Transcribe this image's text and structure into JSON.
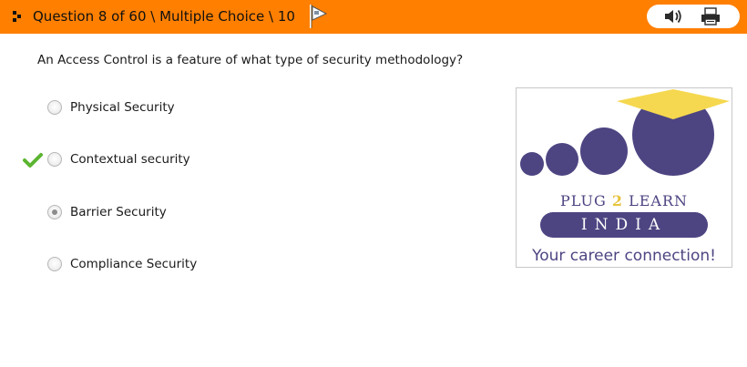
{
  "header": {
    "title": "Question 8 of 60 \\ Multiple Choice \\ 10",
    "colors": {
      "bar": "#ff7f00",
      "pill": "#ffffff"
    },
    "icons": {
      "grip": "grip-icon",
      "flag": "flag-icon",
      "audio": "speaker-icon",
      "print": "printer-icon"
    }
  },
  "question": {
    "text": "An Access Control is a feature of what type of security methodology?"
  },
  "options": [
    {
      "label": "Physical Security",
      "selected": false,
      "correct": false
    },
    {
      "label": "Contextual security",
      "selected": false,
      "correct": true
    },
    {
      "label": "Barrier Security",
      "selected": true,
      "correct": false
    },
    {
      "label": "Compliance Security",
      "selected": false,
      "correct": false
    }
  ],
  "correct_marker": {
    "icon": "checkmark-icon",
    "color": "#5cb531"
  },
  "logo": {
    "brand_part1": "PLUG ",
    "brand_number": "2",
    "brand_part2": " LEARN",
    "india": "INDIA",
    "tagline": "Your career connection!",
    "colors": {
      "purple": "#4d4582",
      "gold": "#e7c43d",
      "cap": "#f5d84f"
    }
  }
}
